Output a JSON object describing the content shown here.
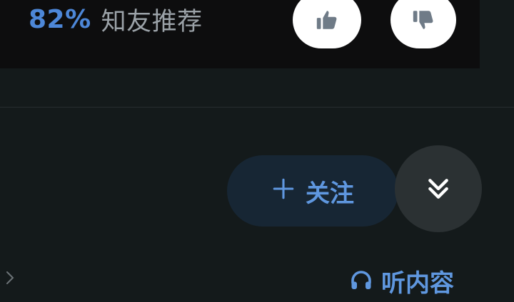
{
  "recommendation": {
    "percent": "82%",
    "label": "知友推荐",
    "upvote_icon": "thumbs-up-icon",
    "downvote_icon": "thumbs-down-icon"
  },
  "actions": {
    "follow_icon": "plus-icon",
    "follow_label": "关注",
    "expand_icon": "double-chevron-down-icon"
  },
  "footer": {
    "chevron_icon": "chevron-right-icon",
    "listen_icon": "headphones-icon",
    "listen_label": "听内容"
  },
  "colors": {
    "background": "#141a1b",
    "accent": "#4d87d8",
    "follow_button_bg": "#172634",
    "expand_button_bg": "#2b3133"
  }
}
